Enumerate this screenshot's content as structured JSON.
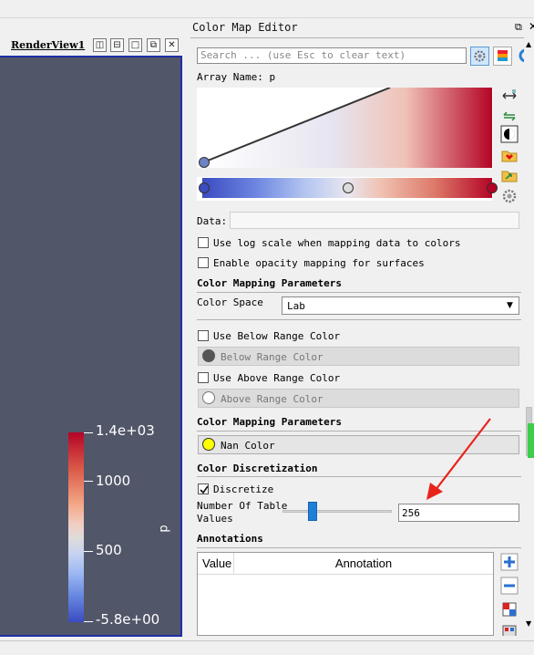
{
  "render_view": {
    "title": "RenderView1",
    "buttons": [
      "split-horizontal",
      "split-vertical",
      "maximize",
      "undock",
      "close"
    ],
    "scalar_bar": {
      "title": "p",
      "max_label": "1.4e+03",
      "mid_high_label": "1000",
      "mid_low_label": "500",
      "min_label": "-5.8e+00",
      "gradient": [
        "#b40426",
        "#dddcdc",
        "#3b4cc0"
      ]
    }
  },
  "editor": {
    "title": "Color Map Editor",
    "search_placeholder": "Search ... (use Esc to clear text)",
    "array_name_label": "Array Name: p",
    "data_label": "Data:",
    "log_scale_label": "Use log scale when mapping data to colors",
    "opacity_mapping_label": "Enable opacity mapping for surfaces",
    "section_mapping_params": "Color Mapping Parameters",
    "color_space_label": "Color Space",
    "color_space_value": "Lab",
    "below_range_checkbox": "Use Below Range Color",
    "below_range_button": "Below Range Color",
    "above_range_checkbox": "Use Above Range Color",
    "above_range_button": "Above Range Color",
    "section_mapping_params_2": "Color Mapping Parameters",
    "nan_color_button": "Nan Color",
    "nan_color": "#ffff00",
    "section_discretization": "Color Discretization",
    "discretize_label": "Discretize",
    "discretize_checked": true,
    "table_values_label_1": "Number Of Table",
    "table_values_label_2": "Values",
    "table_values": "256",
    "section_annotations": "Annotations",
    "annotations_columns": [
      "Value",
      "Annotation"
    ]
  },
  "colors": {
    "viewport_bg": "#525669",
    "view_border": "#1d2fa6",
    "annotation_arrow": "#e8231a",
    "colormap_low": "#3b4cc0",
    "colormap_high": "#b40426"
  }
}
